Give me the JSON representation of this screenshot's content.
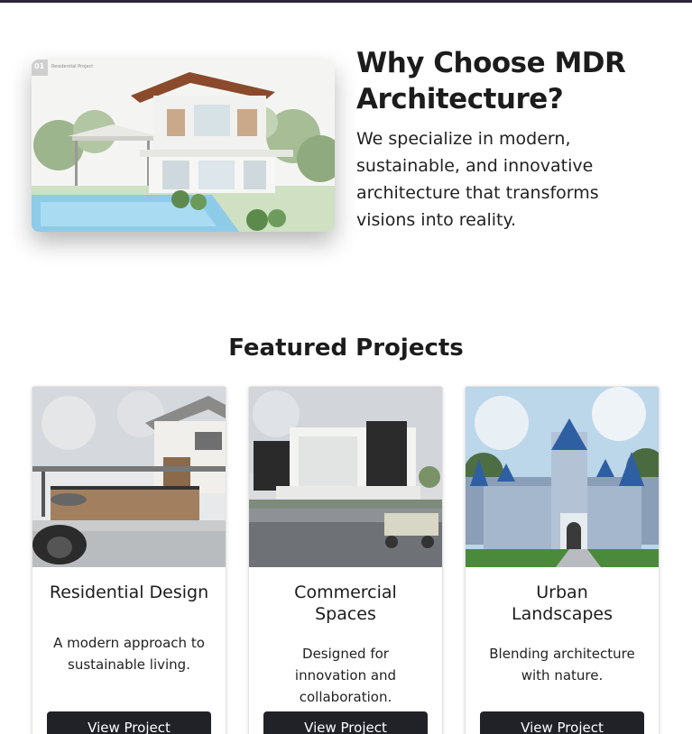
{
  "why": {
    "image_tag_number": "01",
    "image_tag_label": "Residential Project",
    "title": "Why Choose MDR Architecture?",
    "text": "We specialize in modern, sustainable, and innovative architecture that transforms visions into reality."
  },
  "featured": {
    "title": "Featured Projects",
    "cards": [
      {
        "title": "Residential Design",
        "desc": "A modern approach to sustainable living.",
        "button": "View Project",
        "image": "residential-house-render"
      },
      {
        "title": "Commercial Spaces",
        "desc": "Designed for innovation and collaboration.",
        "button": "View Project",
        "image": "commercial-building-render"
      },
      {
        "title": "Urban Landscapes",
        "desc": "Blending architecture with nature.",
        "button": "View Project",
        "image": "castle-render"
      }
    ]
  },
  "colors": {
    "heading": "#1c1c1c",
    "button_bg": "#202227",
    "button_text": "#ffffff",
    "top_bar": "#2a2638"
  }
}
